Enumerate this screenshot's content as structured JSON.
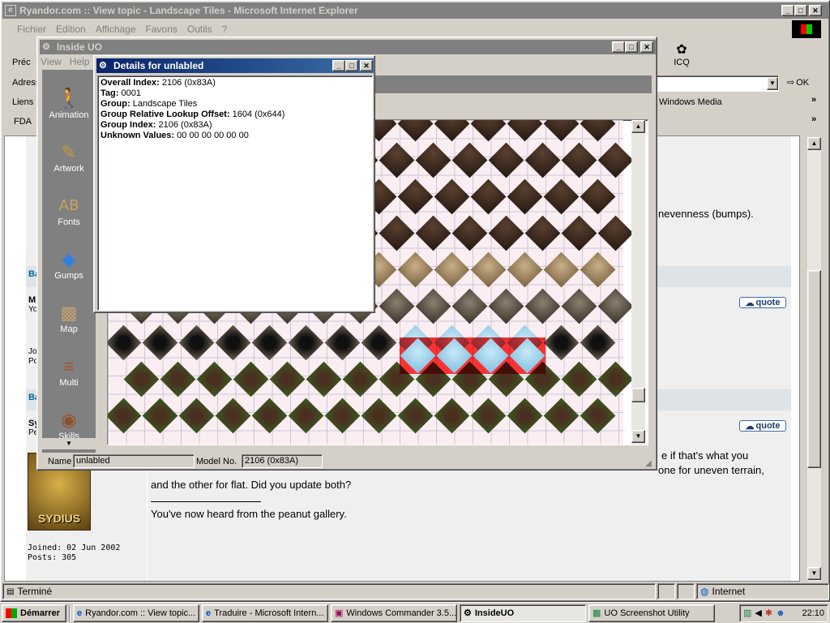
{
  "ie": {
    "title": "Ryandor.com :: View topic - Landscape Tiles - Microsoft Internet Explorer",
    "menu": [
      "Fichier",
      "Edition",
      "Affichage",
      "Favoris",
      "Outils",
      "?"
    ],
    "back_label": "Préc",
    "icq_label": "ICQ",
    "address_label": "Adresse",
    "go_label": "OK",
    "links_label": "Liens",
    "windows_media_label": "Windows Media",
    "fda_label": "FDA",
    "status_text": "Terminé",
    "zone_text": "Internet",
    "post_text_1": "nevenness (bumps).",
    "post_text_2": "e if that's what you",
    "post_text_3": "one for uneven terrain,",
    "post_text_4": "and the other for flat. Did you update both?",
    "signature": "You've now heard from the peanut gallery.",
    "quote_label": "quote",
    "joined": "Joined: 02 Jun 2002",
    "posts": "Posts: 305",
    "avatar_text": "SYDIUS",
    "cut_a": "Ba",
    "cut_m": "M",
    "cut_yo": "Yo",
    "cut_jo": "Jo",
    "cut_po": "Po",
    "cut_sy": "Sy",
    "cut_pe": "Pe"
  },
  "insideuo": {
    "title": "Inside UO",
    "menu": [
      "View",
      "Help"
    ],
    "sidebar": [
      "Animation",
      "Artwork",
      "Fonts",
      "Gumps",
      "Map",
      "Multi",
      "Skills"
    ],
    "name_label": "Name",
    "name_value": "unlabled",
    "model_label": "Model No.",
    "model_value": "2106 (0x83A)"
  },
  "details": {
    "title": "Details for unlabled",
    "lines": [
      {
        "label": "Overall Index:",
        "value": "2106 (0x83A)"
      },
      {
        "label": "Tag:",
        "value": "0001"
      },
      {
        "label": "Group:",
        "value": "Landscape Tiles"
      },
      {
        "label": "Group Relative Lookup Offset:",
        "value": "1604 (0x644)"
      },
      {
        "label": "Group Index:",
        "value": "2106 (0x83A)"
      },
      {
        "label": "Unknown Values:",
        "value": "00 00 00 00 00 00"
      }
    ]
  },
  "taskbar": {
    "start": "Démarrer",
    "buttons": [
      "Ryandor.com :: View topic...",
      "Traduire - Microsoft Intern...",
      "Windows Commander 3.5...",
      "InsideUO",
      "UO Screenshot Utility"
    ],
    "clock": "22:10"
  },
  "colors": {
    "selection": "#ff1f1f",
    "title_active": "#0a246a",
    "title_inactive": "#808080",
    "desktop": "#008080"
  }
}
